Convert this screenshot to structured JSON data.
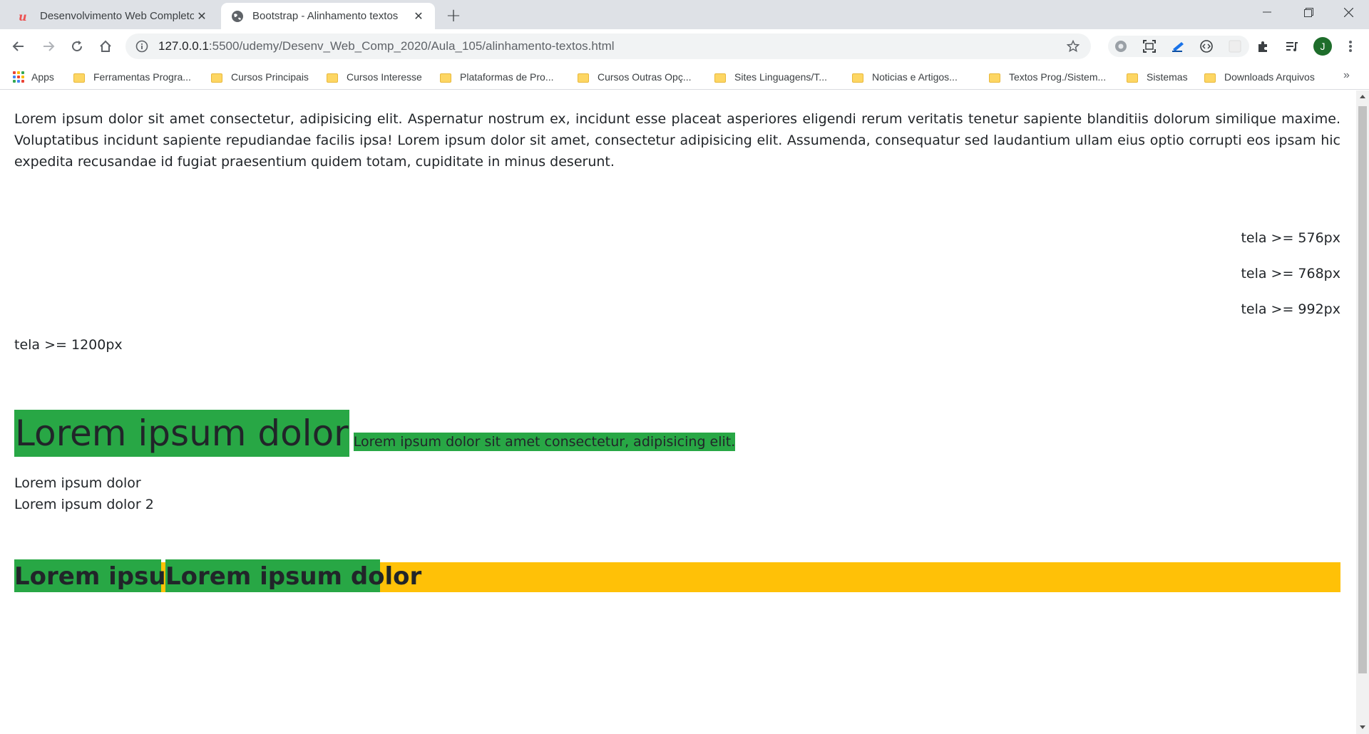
{
  "browser": {
    "tabs": [
      {
        "title": "Desenvolvimento Web Completo",
        "active": false,
        "icon": "udemy-logo-icon"
      },
      {
        "title": "Bootstrap - Alinhamento textos",
        "active": true,
        "icon": "globe-icon"
      }
    ],
    "url_host": "127.0.0.1",
    "url_rest": ":5500/udemy/Desenv_Web_Comp_2020/Aula_105/alinhamento-textos.html",
    "avatar_letter": "J",
    "bookmarks": [
      "Apps",
      "Ferramentas Progra...",
      "Cursos Principais",
      "Cursos Interesse",
      "Plataformas de Pro...",
      "Cursos Outras Opç...",
      "Sites Linguagens/T...",
      "Noticias e Artigos...",
      "Textos Prog./Sistem...",
      "Sistemas",
      "Downloads Arquivos"
    ],
    "bookmarks_more": "»"
  },
  "page": {
    "paragraph": "Lorem ipsum dolor sit amet consectetur, adipisicing elit. Aspernatur nostrum ex, incidunt esse placeat asperiores eligendi rerum veritatis tenetur sapiente blanditiis dolorum similique maxime. Voluptatibus incidunt sapiente repudiandae facilis ipsa! Lorem ipsum dolor sit amet, consectetur adipisicing elit. Assumenda, consequatur sed laudantium ullam eius optio corrupti eos ipsam hic expedita recusandae id fugiat praesentium quidem totam, cupiditate in minus deserunt.",
    "tela_576": "tela >= 576px",
    "tela_768": "tela >= 768px",
    "tela_992": "tela >= 992px",
    "tela_1200": "tela >= 1200px",
    "big_heading": "Lorem ipsum dolor",
    "small_heading": "Lorem ipsum dolor sit amet consectetur, adipisicing elit.",
    "line_1": "Lorem ipsum dolor",
    "line_2": "Lorem ipsum dolor 2",
    "box_1": "Lorem ipsum",
    "box_2": "Lorem ipsum dolor"
  },
  "colors": {
    "green": "#28a745",
    "yellow": "#ffc107",
    "text": "#212529"
  }
}
